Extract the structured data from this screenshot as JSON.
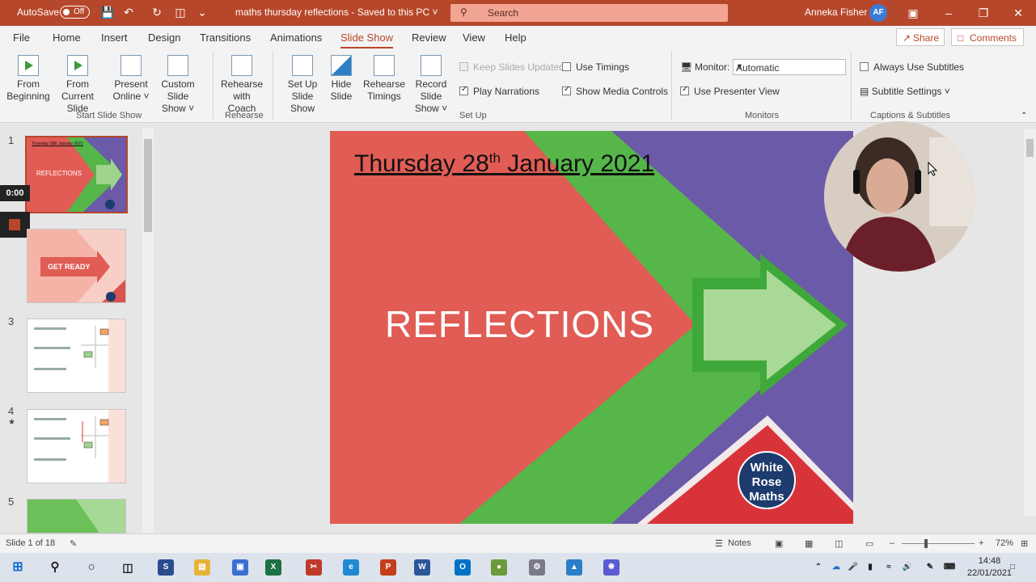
{
  "titlebar": {
    "autosave_label": "AutoSave",
    "autosave_state": "Off",
    "document_title": "maths thursday reflections  -  Saved to this PC  ˅",
    "search_placeholder": "Search",
    "user_name": "Anneka Fisher",
    "user_initials": "AF",
    "bg_color": "#b7472a"
  },
  "menu": {
    "items": [
      "File",
      "Home",
      "Insert",
      "Design",
      "Transitions",
      "Animations",
      "Slide Show",
      "Review",
      "View",
      "Help"
    ],
    "active": "Slide Show",
    "share_label": "Share",
    "comments_label": "Comments"
  },
  "ribbon": {
    "start": {
      "from_beginning_1": "From",
      "from_beginning_2": "Beginning",
      "from_current_1": "From",
      "from_current_2": "Current Slide",
      "present_online_1": "Present",
      "present_online_2": "Online ˅",
      "custom_show_1": "Custom Slide",
      "custom_show_2": "Show ˅",
      "label": "Start Slide Show"
    },
    "rehearse": {
      "coach_1": "Rehearse",
      "coach_2": "with Coach",
      "label": "Rehearse"
    },
    "setup": {
      "setup_show_1": "Set Up",
      "setup_show_2": "Slide Show",
      "hide_1": "Hide",
      "hide_2": "Slide",
      "timings_1": "Rehearse",
      "timings_2": "Timings",
      "record_1": "Record Slide",
      "record_2": "Show ˅",
      "keep_updated": "Keep Slides Updated",
      "play_narrations": "Play Narrations",
      "use_timings": "Use Timings",
      "show_media": "Show Media Controls",
      "label": "Set Up"
    },
    "monitors": {
      "monitor_label": "Monitor:",
      "monitor_value": "Automatic",
      "presenter_view": "Use Presenter View",
      "label": "Monitors"
    },
    "captions": {
      "always_subtitles": "Always Use Subtitles",
      "subtitle_settings": "Subtitle Settings ˅",
      "label": "Captions & Subtitles"
    }
  },
  "thumbnails": {
    "numbers": [
      "1",
      "3",
      "4",
      "5"
    ],
    "timer": "0:00",
    "slide1_title": "REFLECTIONS",
    "slide1_date": "Thursday 28th January 2021",
    "slide2_label": "GET READY",
    "slide4_star": "★"
  },
  "slide": {
    "date_pre": "Thursday 28",
    "date_sup": "th",
    "date_post": " January 2021",
    "title": "REFLECTIONS",
    "logo_line1": "White",
    "logo_line2": "Rose",
    "logo_line3": "Maths"
  },
  "status": {
    "slide_of": "Slide 1 of 18",
    "notes": "Notes",
    "zoom": "72%"
  },
  "taskbar": {
    "time": "14:48",
    "date": "22/01/2021"
  }
}
